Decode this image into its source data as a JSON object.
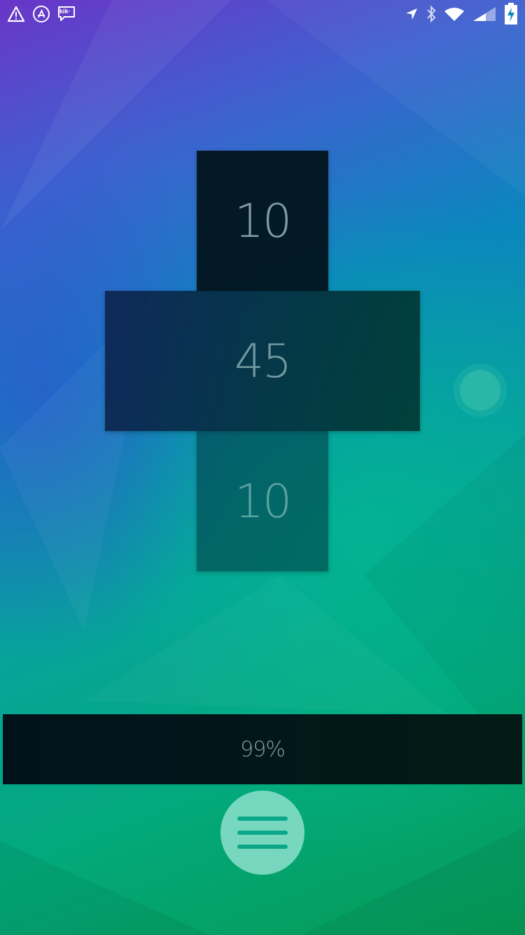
{
  "status_bar": {
    "left_icons": [
      "alert-icon",
      "app-store-icon",
      "kik-icon"
    ],
    "kik_label": "kik·",
    "right_icons": [
      "location-icon",
      "bluetooth-icon",
      "wifi-icon",
      "cell-signal-icon",
      "battery-charging-icon"
    ]
  },
  "picker": {
    "top_value": "10",
    "selected_value": "45",
    "bottom_value": "10"
  },
  "progress": {
    "label": "99%",
    "value": 0.99
  },
  "side_control": {
    "icon": "circle-handle-icon"
  },
  "menu_button": {
    "icon": "hamburger-menu-icon"
  },
  "colors": {
    "menu_button": "#8ce1cd",
    "menu_lines": "#0aa888",
    "bottom_bar": "#02171a"
  }
}
